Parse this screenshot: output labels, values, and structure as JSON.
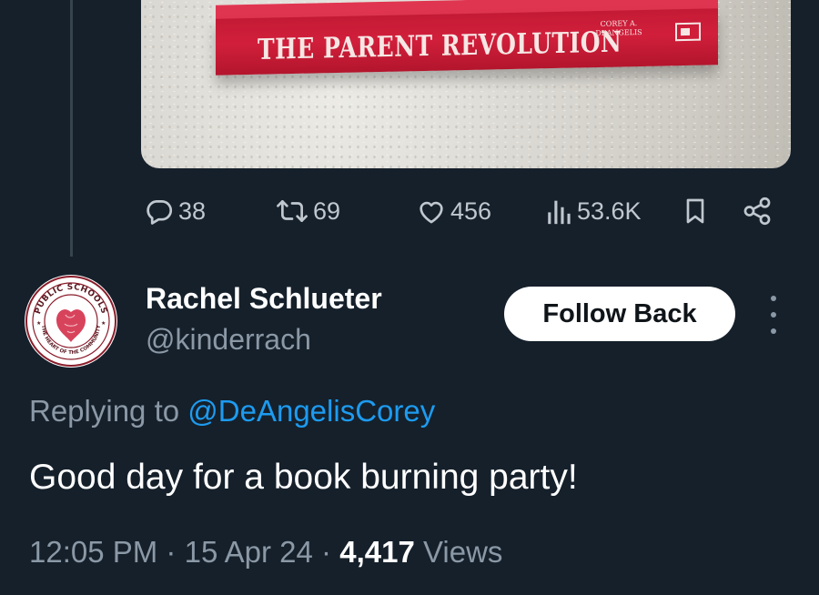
{
  "media": {
    "book_title": "THE PARENT REVOLUTION",
    "book_author": "Corey A. DeAngelis"
  },
  "actions": {
    "replies": "38",
    "reposts": "69",
    "likes": "456",
    "views": "53.6K"
  },
  "author": {
    "name": "Rachel Schlueter",
    "handle": "@kinderrach",
    "avatar_ring_top": "PUBLIC SCHOOLS",
    "avatar_ring_bottom": "THE HEART OF THE COMMUNITY"
  },
  "follow_button_label": "Follow Back",
  "reply": {
    "prefix": "Replying to",
    "mention": "@DeAngelisCorey"
  },
  "tweet": {
    "text": "Good day for a book burning party!"
  },
  "meta": {
    "time": "12:05 PM",
    "separator": "·",
    "date": "15 Apr 24",
    "views_count": "4,417",
    "views_label": "Views"
  },
  "colors": {
    "background": "#15202b",
    "mention": "#1d9bf0",
    "muted": "#8b98a5",
    "book_red": "#c41a35"
  },
  "icons": {
    "reply": "reply-icon",
    "repost": "repost-icon",
    "like": "heart-icon",
    "views": "analytics-icon",
    "bookmark": "bookmark-icon",
    "share": "share-icon",
    "more": "more-icon"
  }
}
